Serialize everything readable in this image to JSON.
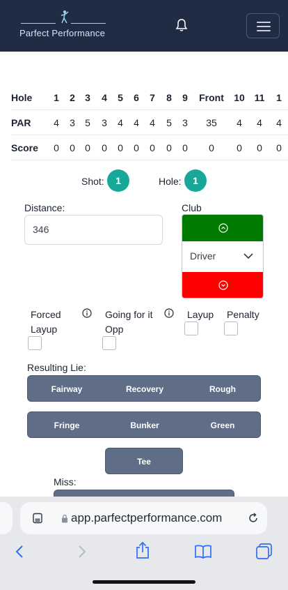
{
  "header": {
    "brand": "Parfect Performance",
    "bell_icon": "bell-icon",
    "menu_icon": "hamburger-menu-icon"
  },
  "scorecard": {
    "headers": [
      "Hole",
      "1",
      "2",
      "3",
      "4",
      "5",
      "6",
      "7",
      "8",
      "9",
      "Front",
      "10",
      "11",
      "1"
    ],
    "par": [
      "PAR",
      "4",
      "3",
      "5",
      "3",
      "4",
      "4",
      "4",
      "5",
      "3",
      "35",
      "4",
      "4",
      "4"
    ],
    "score": [
      "Score",
      "0",
      "0",
      "0",
      "0",
      "0",
      "0",
      "0",
      "0",
      "0",
      "0",
      "0",
      "0",
      "0"
    ]
  },
  "status": {
    "shot_label": "Shot:",
    "shot_value": "1",
    "hole_label": "Hole:",
    "hole_value": "1"
  },
  "form": {
    "distance_label": "Distance:",
    "distance_value": "346",
    "club_label": "Club",
    "club_value": "Driver",
    "club_up_color": "#007a00",
    "club_down_color": "#ff0000",
    "checks": {
      "forced_layup_line1": "Forced",
      "forced_layup_line2": "Layup",
      "going_for_it_line1": "Going for it",
      "going_for_it_line2": "Opp",
      "layup": "Layup",
      "penalty": "Penalty"
    },
    "resulting_lie_label": "Resulting Lie:",
    "lie_row1": [
      "Fairway",
      "Recovery",
      "Rough"
    ],
    "lie_row2": [
      "Fringe",
      "Bunker",
      "Green"
    ],
    "lie_tee": "Tee",
    "miss_label": "Miss:"
  },
  "browser": {
    "url": "app.parfectperformance.com",
    "toolbar_icons": [
      "back-icon",
      "forward-icon",
      "share-icon",
      "bookmarks-icon",
      "tabs-icon"
    ]
  },
  "colors": {
    "header_bg": "#1f2c44",
    "badge": "#17a89a",
    "option_button": "#5f6e86"
  }
}
